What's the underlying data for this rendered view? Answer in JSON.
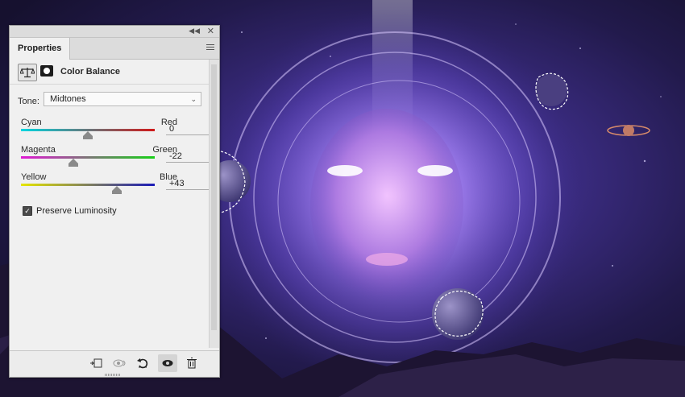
{
  "panel": {
    "tab_label": "Properties",
    "adjustment_title": "Color Balance",
    "tone_label": "Tone:",
    "tone_value": "Midtones",
    "sliders": [
      {
        "left": "Cyan",
        "right": "Red",
        "value": "0",
        "level": 0
      },
      {
        "left": "Magenta",
        "right": "Green",
        "value": "-22",
        "level": -22
      },
      {
        "left": "Yellow",
        "right": "Blue",
        "value": "+43",
        "level": 43
      }
    ],
    "preserve_label": "Preserve Luminosity",
    "preserve_checked": true,
    "footer_icons": [
      "clip-to-layer-icon",
      "view-previous-state-icon",
      "reset-icon",
      "visibility-eye-icon",
      "trash-icon"
    ]
  },
  "colors": {
    "cyan": "#00d6e0",
    "red": "#d01818",
    "magenta": "#e01ad4",
    "green": "#18d018",
    "yellow": "#e6e600",
    "blue": "#1a1ab8"
  }
}
